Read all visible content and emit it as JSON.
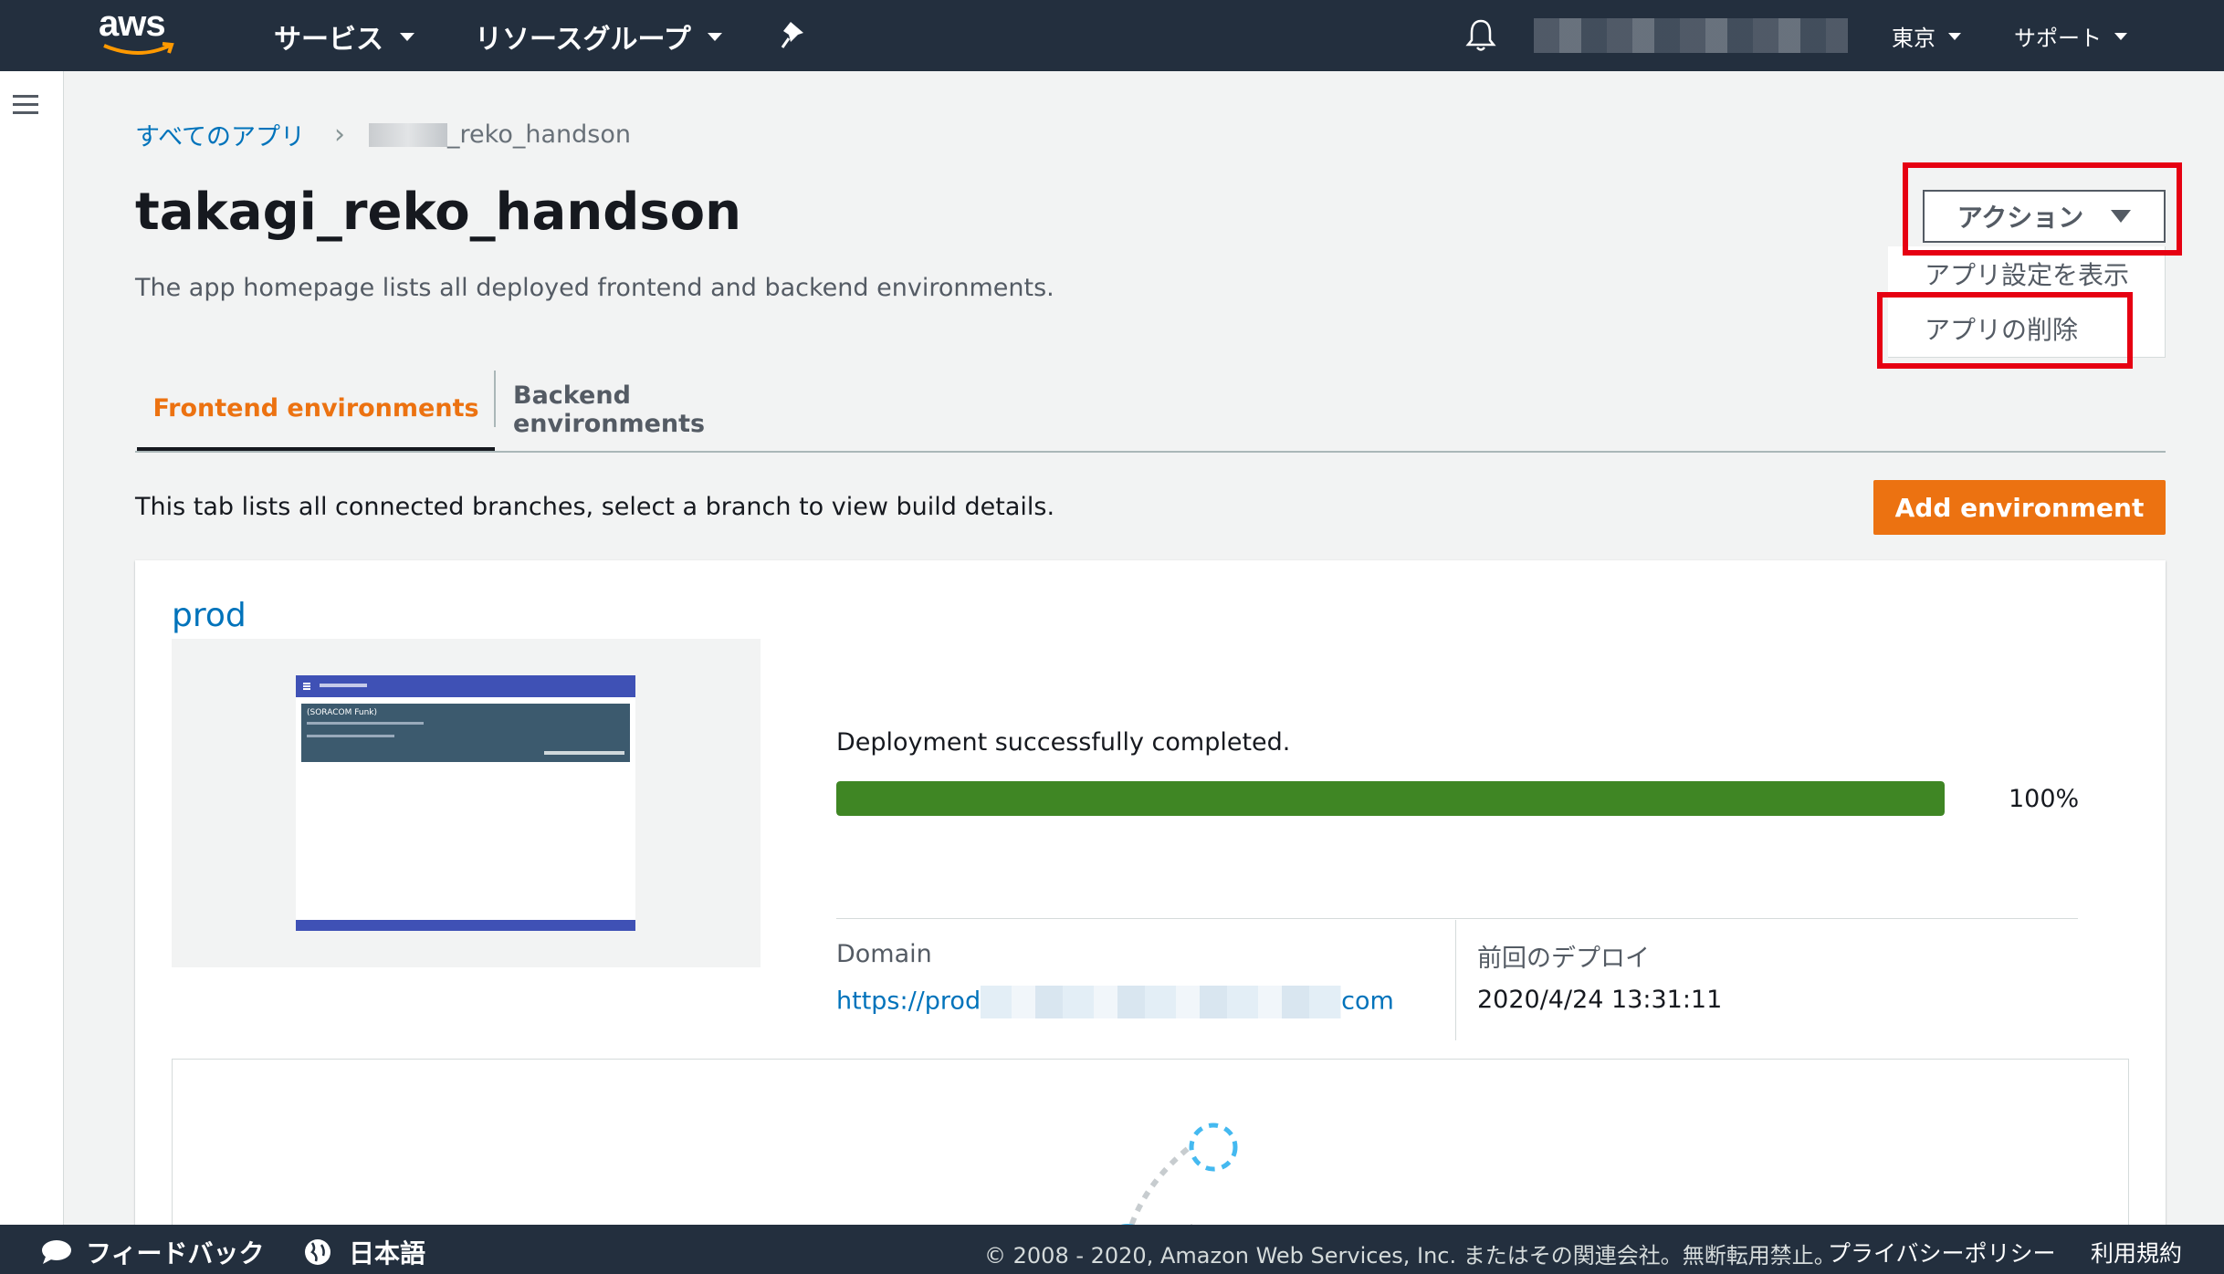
{
  "topnav": {
    "logo_text": "aws",
    "services_label": "サービス",
    "resource_groups_label": "リソースグループ",
    "region_label": "東京",
    "support_label": "サポート"
  },
  "breadcrumb": {
    "root": "すべてのアプリ",
    "current_suffix": "_reko_handson"
  },
  "page": {
    "title": "takagi_reko_handson",
    "description": "The app homepage lists all deployed frontend and backend environments."
  },
  "actions": {
    "button_label": "アクション",
    "menu_items": [
      "アプリ設定を表示",
      "アプリの削除"
    ]
  },
  "tabs": [
    {
      "label": "Frontend environments",
      "active": true
    },
    {
      "label": "Backend environments",
      "active": false
    }
  ],
  "tab_description": "This tab lists all connected branches, select a branch to view build details.",
  "add_environment_label": "Add environment",
  "branch": {
    "name": "prod",
    "status_text": "Deployment successfully completed.",
    "progress": 100,
    "progress_label": "100%",
    "domain_label": "Domain",
    "domain_prefix": "https://prod",
    "domain_suffix": "com",
    "last_deploy_label": "前回のデプロイ",
    "last_deploy_value": "2020/4/24 13:31:11",
    "preview": {
      "panel_title": "(SORACOM Funk)"
    }
  },
  "footer": {
    "feedback_label": "フィードバック",
    "language_label": "日本語",
    "copyright": "© 2008 - 2020, Amazon Web Services, Inc. またはその関連会社。無断転用禁止。",
    "privacy_label": "プライバシーポリシー",
    "terms_label": "利用規約"
  },
  "colors": {
    "accent": "#ec7211",
    "link": "#0073bb",
    "nav_bg": "#232f3e",
    "progress": "#3f8624",
    "highlight": "#e60012"
  }
}
